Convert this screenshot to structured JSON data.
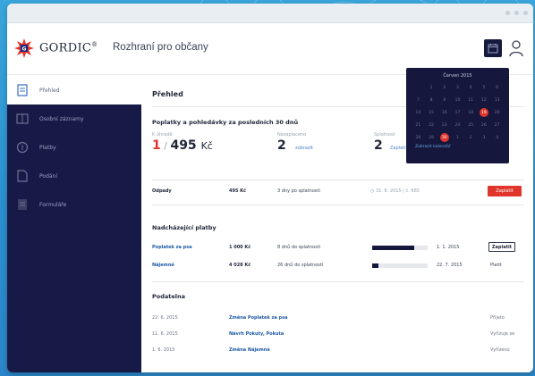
{
  "brand": {
    "logo_text": "GORDIC",
    "tm": "®",
    "app_title": "Rozhraní pro občany"
  },
  "sidebar": {
    "items": [
      {
        "label": "Přehled",
        "icon": "dashboard-icon",
        "active": true
      },
      {
        "label": "Osobní záznamy",
        "icon": "card-icon",
        "active": false
      },
      {
        "label": "Platby",
        "icon": "payment-icon",
        "active": false
      },
      {
        "label": "Podání",
        "icon": "document-icon",
        "active": false
      },
      {
        "label": "Formuláře",
        "icon": "form-icon",
        "active": false
      }
    ]
  },
  "main": {
    "title": "Přehled",
    "summary": {
      "title": "Poplatky a pohledávky za posledních 30 dnů",
      "col1": {
        "caption": "K úhradě",
        "value_red": "1",
        "sep": " / ",
        "value": "495",
        "unit": "Kč"
      },
      "col2": {
        "caption": "Nezaplaceno",
        "value": "2",
        "link": "zobrazit"
      },
      "col3": {
        "caption": "Splatnost",
        "value": "2",
        "link": "Zaplatit"
      }
    },
    "odpady": {
      "label": "Odpady",
      "amount": "495 Kč",
      "info": "3 dny po splatnosti",
      "due": "31. 8. 2015 | č. 685",
      "button": "Zaplatit"
    },
    "upcoming": {
      "title": "Nadcházející platby",
      "rows": [
        {
          "name": "Poplatek za psa",
          "amount": "1 000 Kč",
          "days": "8 dnů do splatnosti",
          "progress": 0.75,
          "date": "1. 1. 2015",
          "action": "Zaplatit",
          "action_is_button": true
        },
        {
          "name": "Nájemné",
          "amount": "4 028 Kč",
          "days": "26 dnů do splatnosti",
          "progress": 0.12,
          "date": "22. 7. 2015",
          "action": "Platit",
          "action_is_button": false
        }
      ]
    },
    "mailbox": {
      "title": "Podatelna",
      "rows": [
        {
          "date": "22. 6. 2015",
          "subject": "Změna Poplatek za psa",
          "status": "Přijato"
        },
        {
          "date": "11. 6. 2015",
          "subject": "Návrh Pokuty, Pokuta",
          "status": "Vyřizuje se"
        },
        {
          "date": "1. 6. 2015",
          "subject": "Změna Nájemné",
          "status": "Vyřízeno"
        }
      ]
    }
  },
  "calendar": {
    "month": "Červen 2015",
    "days": [
      "",
      "1",
      "2",
      "3",
      "4",
      "5",
      "6",
      "7",
      "8",
      "9",
      "10",
      "11",
      "12",
      "13",
      "14",
      "15",
      "16",
      "17",
      "18",
      "19",
      "20",
      "21",
      "22",
      "23",
      "24",
      "25",
      "26",
      "27",
      "28",
      "29",
      "30",
      "1",
      "2",
      "3",
      "4"
    ],
    "marked": [
      "19",
      "30"
    ],
    "link": "Zobrazit kalendář"
  },
  "colors": {
    "navy": "#171a46",
    "red": "#e0352c",
    "bg_blue": "#2b8fcf"
  }
}
